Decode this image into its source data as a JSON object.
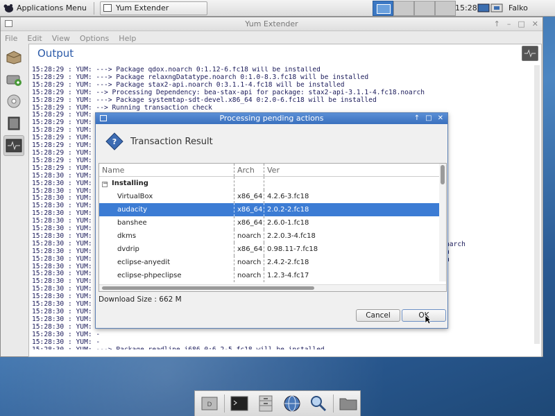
{
  "top_panel": {
    "app_menu_label": "Applications Menu",
    "task_label": "Yum Extender",
    "clock": "15:28",
    "user": "Falko Timme"
  },
  "window": {
    "title": "Yum Extender",
    "menu": [
      "File",
      "Edit",
      "View",
      "Options",
      "Help"
    ],
    "output_title": "Output",
    "log_lines": [
      "15:28:29 : YUM: ---> Package qdox.noarch 0:1.12-6.fc18 will be installed",
      "15:28:29 : YUM: ---> Package relaxngDatatype.noarch 0:1.0-8.3.fc18 will be installed",
      "15:28:29 : YUM: ---> Package stax2-api.noarch 0:3.1.1-4.fc18 will be installed",
      "15:28:29 : YUM: --> Processing Dependency: bea-stax-api for package: stax2-api-3.1.1-4.fc18.noarch",
      "15:28:29 : YUM: ---> Package systemtap-sdt-devel.x86_64 0:2.0-6.fc18 will be installed",
      "15:28:29 : YUM: --> Running transaction check",
      "15:28:29 : YUM: -",
      "15:28:29 : YUM: -",
      "15:28:29 : YUM: -",
      "15:28:29 : YUM: -",
      "15:28:29 : YUM: -",
      "15:28:29 : YUM: -",
      "15:28:29 : YUM: -",
      "15:28:29 : YUM: -",
      "15:28:30 : YUM: -",
      "15:28:30 : YUM: -",
      "15:28:30 : YUM: -",
      "15:28:30 : YUM: -",
      "15:28:30 : YUM: -",
      "15:28:30 : YUM: -",
      "15:28:30 : YUM: -",
      "15:28:30 : YUM: -",
      "15:28:30 : YUM: -",
      "15:28:30 : YUM: -",
      "15:28:30 : YUM: -",
      "15:28:30 : YUM: -",
      "15:28:30 : YUM: -",
      "15:28:30 : YUM: -",
      "15:28:30 : YUM: -",
      "15:28:30 : YUM: -",
      "15:28:30 : YUM: -",
      "15:28:30 : YUM: -",
      "15:28:30 : YUM: -",
      "15:28:30 : YUM: -",
      "15:28:30 : YUM: -",
      "15:28:30 : YUM: -",
      "15:28:30 : YUM: -",
      "15:28:30 : YUM: ---> Package readline.i686 0:6.2-5.fc18 will be installed",
      "15:28:30 : YUM: --> Finished Dependency Resolution"
    ],
    "log_fragments": [
      "narch",
      "h",
      "h"
    ]
  },
  "dialog": {
    "title": "Processing pending actions",
    "heading": "Transaction Result",
    "columns": [
      "Name",
      "Arch",
      "Ver"
    ],
    "group": "Installing",
    "rows": [
      {
        "name": "VirtualBox",
        "arch": "x86_64",
        "ver": "4.2.6-3.fc18"
      },
      {
        "name": "audacity",
        "arch": "x86_64",
        "ver": "2.0.2-2.fc18"
      },
      {
        "name": "banshee",
        "arch": "x86_64",
        "ver": "2.6.0-1.fc18"
      },
      {
        "name": "dkms",
        "arch": "noarch",
        "ver": "2.2.0.3-4.fc18"
      },
      {
        "name": "dvdrip",
        "arch": "x86_64",
        "ver": "0.98.11-7.fc18"
      },
      {
        "name": "eclipse-anyedit",
        "arch": "noarch",
        "ver": "2.4.2-2.fc18"
      },
      {
        "name": "eclipse-phpeclipse",
        "arch": "noarch",
        "ver": "1.2.3-4.fc17"
      }
    ],
    "selected_row": 1,
    "download_size": "Download Size : 662 M",
    "cancel_label": "Cancel",
    "ok_label": "OK"
  },
  "colors": {
    "accent": "#3c7cd4",
    "output_title": "#2b5aa8",
    "dialog_title": "#3a70be"
  }
}
